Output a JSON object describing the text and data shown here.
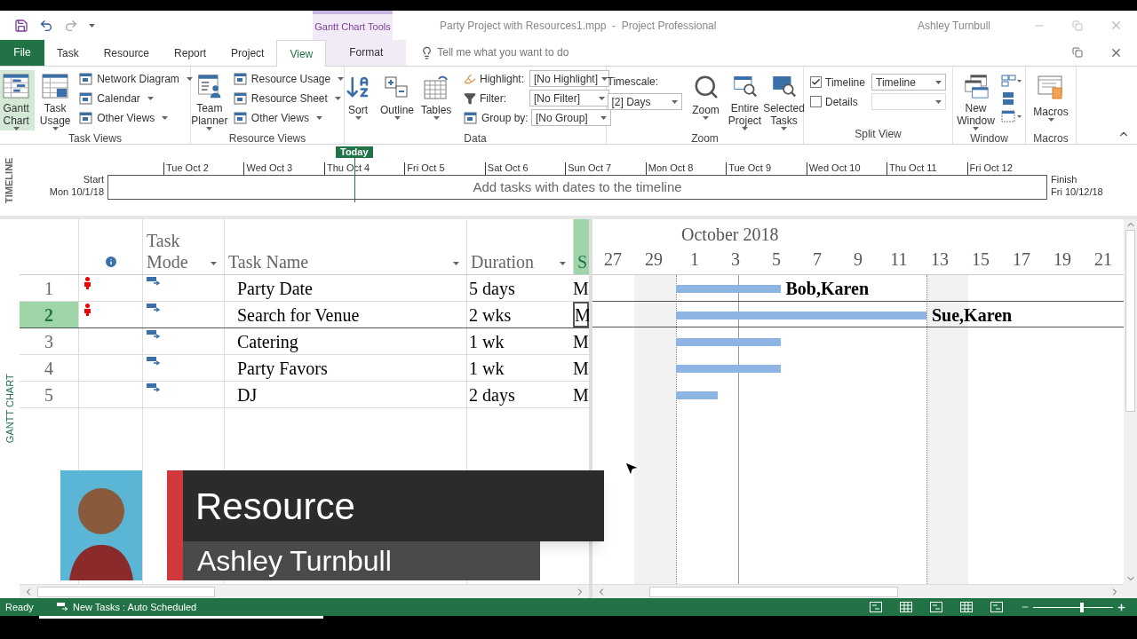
{
  "window": {
    "title": "Party Project with Resources1.mpp  -  Project Professional",
    "user": "Ashley Turnbull",
    "contextual_group": "Gantt Chart Tools"
  },
  "tabs": [
    {
      "label": "File",
      "kind": "file",
      "selected": false
    },
    {
      "label": "Task",
      "kind": "tab",
      "selected": false
    },
    {
      "label": "Resource",
      "kind": "tab",
      "selected": false
    },
    {
      "label": "Report",
      "kind": "tab",
      "selected": false
    },
    {
      "label": "Project",
      "kind": "tab",
      "selected": false
    },
    {
      "label": "View",
      "kind": "tab",
      "selected": true
    },
    {
      "label": "Format",
      "kind": "contextual",
      "selected": false
    }
  ],
  "tell_me": {
    "placeholder": "Tell me what you want to do"
  },
  "ribbon": {
    "groups": [
      {
        "label": "Task Views",
        "kind": "views",
        "large": [
          {
            "label": "Gantt Chart",
            "selected": true
          },
          {
            "label": "Task Usage",
            "selected": false
          }
        ],
        "small": [
          {
            "label": "Network Diagram"
          },
          {
            "label": "Calendar"
          },
          {
            "label": "Other Views"
          }
        ]
      },
      {
        "label": "Resource Views",
        "kind": "views",
        "large": [
          {
            "label": "Team Planner",
            "selected": false
          }
        ],
        "small": [
          {
            "label": "Resource Usage"
          },
          {
            "label": "Resource Sheet"
          },
          {
            "label": "Other Views"
          }
        ]
      },
      {
        "label": "Data",
        "kind": "data",
        "large": [
          {
            "label": "Sort"
          },
          {
            "label": "Outline"
          },
          {
            "label": "Tables"
          }
        ],
        "fields": [
          {
            "label": "Highlight:",
            "value": "[No Highlight]"
          },
          {
            "label": "Filter:",
            "value": "[No Filter]"
          },
          {
            "label": "Group by:",
            "value": "[No Group]"
          }
        ]
      },
      {
        "label": "Zoom",
        "kind": "zoom",
        "field": {
          "label": "Timescale:",
          "value": "[2] Days"
        },
        "large": [
          {
            "label": "Zoom"
          },
          {
            "label": "Entire Project"
          },
          {
            "label": "Selected Tasks"
          }
        ]
      },
      {
        "label": "Split View",
        "kind": "split",
        "checks": [
          {
            "label": "Timeline",
            "checked": true,
            "value": "Timeline"
          },
          {
            "label": "Details",
            "checked": false
          }
        ]
      },
      {
        "label": "Window",
        "kind": "window",
        "large": [
          {
            "label": "New Window"
          }
        ]
      },
      {
        "label": "Macros",
        "kind": "macros",
        "large": [
          {
            "label": "Macros"
          }
        ]
      }
    ]
  },
  "timeline": {
    "label": "TIMELINE",
    "today": "Today",
    "start_label": "Start",
    "start_date": "Mon 10/1/18",
    "finish_label": "Finish",
    "finish_date": "Fri 10/12/18",
    "placeholder": "Add tasks with dates to the timeline",
    "ticks": [
      "Tue Oct 2",
      "Wed Oct 3",
      "Thu Oct 4",
      "Fri Oct 5",
      "Sat Oct 6",
      "Sun Oct 7",
      "Mon Oct 8",
      "Tue Oct 9",
      "Wed Oct 10",
      "Thu Oct 11",
      "Fri Oct 12"
    ]
  },
  "view_label": "GANTT CHART",
  "table": {
    "columns": [
      {
        "label": "Task Mode"
      },
      {
        "label": "Task Name"
      },
      {
        "label": "Duration"
      },
      {
        "label": "S",
        "selected": true
      }
    ],
    "rows": [
      {
        "id": "1",
        "name": "Party Date",
        "duration": "5 days",
        "start": "M",
        "indicator": true,
        "selected": false,
        "resources": "Bob,Karen"
      },
      {
        "id": "2",
        "name": "Search for Venue",
        "duration": "2 wks",
        "start": "M",
        "indicator": true,
        "selected": true,
        "resources": "Sue,Karen"
      },
      {
        "id": "3",
        "name": "Catering",
        "duration": "1 wk",
        "start": "M",
        "indicator": false,
        "selected": false
      },
      {
        "id": "4",
        "name": "Party Favors",
        "duration": "1 wk",
        "start": "M",
        "indicator": false,
        "selected": false
      },
      {
        "id": "5",
        "name": "DJ",
        "duration": "2 days",
        "start": "M",
        "indicator": false,
        "selected": false
      }
    ]
  },
  "gantt": {
    "month": "October 2018",
    "days": [
      "27",
      "29",
      "1",
      "3",
      "5",
      "7",
      "9",
      "11",
      "13",
      "15",
      "17",
      "19",
      "21"
    ]
  },
  "overlay": {
    "title": "Resource",
    "name": "Ashley Turnbull"
  },
  "status_bar": {
    "ready": "Ready",
    "mode": "New Tasks : Auto Scheduled",
    "zoom": {
      "level": 0.62
    }
  }
}
